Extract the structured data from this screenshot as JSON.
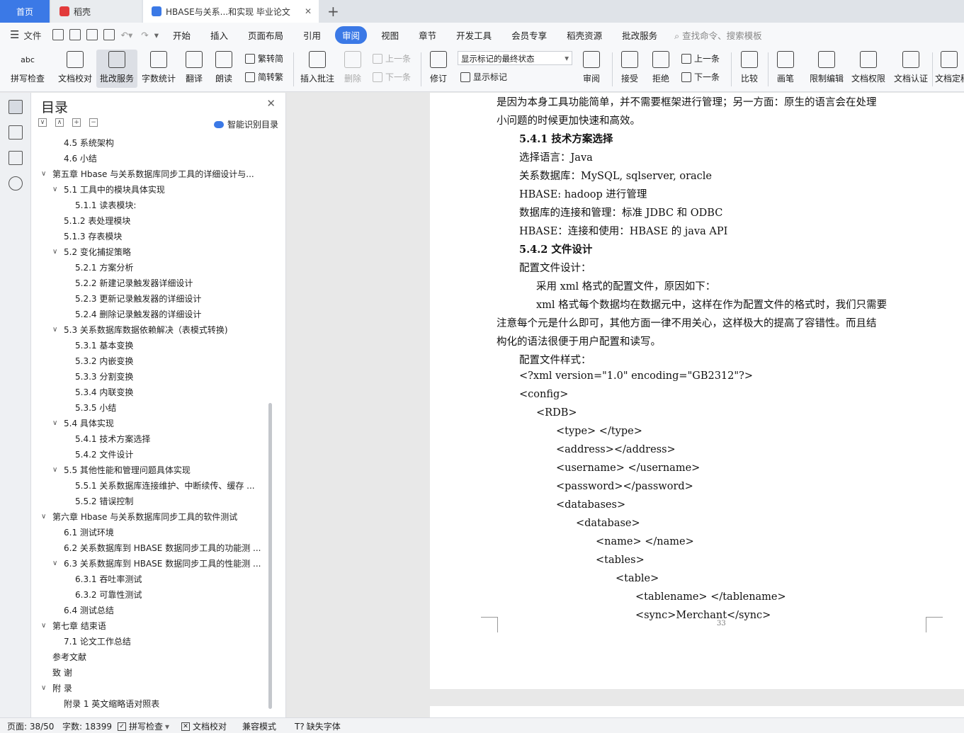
{
  "tabs": {
    "home": "首页",
    "daoke": "稻壳",
    "doc": "HBASE与关系...和实现 毕业论文",
    "close": "✕",
    "new": "+"
  },
  "menu": {
    "file": "文件",
    "items": [
      "开始",
      "插入",
      "页面布局",
      "引用",
      "审阅",
      "视图",
      "章节",
      "开发工具",
      "会员专享",
      "稻壳资源",
      "批改服务"
    ],
    "active": "审阅",
    "search": "查找命令、搜索模板"
  },
  "toolbar": {
    "spell": "拼写检查",
    "proof": "文档校对",
    "review_service": "批改服务",
    "wordcount": "字数统计",
    "translate": "翻译",
    "read": "朗读",
    "to_trad": "繁转简",
    "to_simp": "简转繁",
    "insert_comment": "插入批注",
    "delete": "删除",
    "prev_comment": "上一条",
    "next_comment": "下一条",
    "revise": "修订",
    "markup_state": "显示标记的最终状态",
    "show_markup": "显示标记",
    "review": "审阅",
    "accept": "接受",
    "reject": "拒绝",
    "prev_change": "上一条",
    "next_change": "下一条",
    "compare": "比较",
    "draw": "画笔",
    "restrict": "限制编辑",
    "permission": "文档权限",
    "certify": "文档认证",
    "finalize": "文档定稿"
  },
  "toc": {
    "title": "目录",
    "smart": "智能识别目录",
    "items": [
      {
        "text": "4.5  系统架构",
        "level": 2,
        "car": ""
      },
      {
        "text": "4.6  小结",
        "level": 2,
        "car": ""
      },
      {
        "text": "第五章   Hbase 与关系数据库同步工具的详细设计与...",
        "level": 1,
        "car": "∨"
      },
      {
        "text": "5.1   工具中的模块具体实现",
        "level": 2,
        "car": "∨"
      },
      {
        "text": "5.1.1   读表模块:",
        "level": 3,
        "car": ""
      },
      {
        "text": "5.1.2   表处理模块",
        "level": 2,
        "car": ""
      },
      {
        "text": "5.1.3   存表模块",
        "level": 2,
        "car": ""
      },
      {
        "text": "5.2   变化捕捉策略",
        "level": 2,
        "car": "∨"
      },
      {
        "text": "5.2.1   方案分析",
        "level": 3,
        "car": ""
      },
      {
        "text": "5.2.2   新建记录触发器详细设计",
        "level": 3,
        "car": ""
      },
      {
        "text": "5.2.3   更新记录触发器的详细设计",
        "level": 3,
        "car": ""
      },
      {
        "text": "5.2.4   删除记录触发器的详细设计",
        "level": 3,
        "car": ""
      },
      {
        "text": "5.3   关系数据库数据依赖解决（表模式转换)",
        "level": 2,
        "car": "∨"
      },
      {
        "text": "5.3.1   基本变换",
        "level": 3,
        "car": ""
      },
      {
        "text": "5.3.2   内嵌变换",
        "level": 3,
        "car": ""
      },
      {
        "text": "5.3.3   分割变换",
        "level": 3,
        "car": ""
      },
      {
        "text": "5.3.4   内联变换",
        "level": 3,
        "car": ""
      },
      {
        "text": "5.3.5   小结",
        "level": 3,
        "car": ""
      },
      {
        "text": "5.4   具体实现",
        "level": 2,
        "car": "∨"
      },
      {
        "text": "5.4.1   技术方案选择",
        "level": 3,
        "car": ""
      },
      {
        "text": "5.4.2   文件设计",
        "level": 3,
        "car": ""
      },
      {
        "text": "5.5  其他性能和管理问题具体实现",
        "level": 2,
        "car": "∨"
      },
      {
        "text": "5.5.1   关系数据库连接维护、中断续传、缓存 ...",
        "level": 3,
        "car": ""
      },
      {
        "text": "5.5.2   错误控制",
        "level": 3,
        "car": ""
      },
      {
        "text": "第六章   Hbase 与关系数据库同步工具的软件测试",
        "level": 1,
        "car": "∨"
      },
      {
        "text": "6.1   测试环境",
        "level": 2,
        "car": ""
      },
      {
        "text": "6.2   关系数据库到 HBASE 数据同步工具的功能测 ...",
        "level": 2,
        "car": ""
      },
      {
        "text": "6.3   关系数据库到 HBASE 数据同步工具的性能测 ...",
        "level": 2,
        "car": "∨"
      },
      {
        "text": "6.3.1   吞吐率测试",
        "level": 3,
        "car": ""
      },
      {
        "text": "6.3.2   可靠性测试",
        "level": 3,
        "car": ""
      },
      {
        "text": "6.4   测试总结",
        "level": 2,
        "car": ""
      },
      {
        "text": "第七章    结束语",
        "level": 1,
        "car": "∨"
      },
      {
        "text": "7.1   论文工作总结",
        "level": 2,
        "car": ""
      },
      {
        "text": "参考文献",
        "level": 1,
        "car": ""
      },
      {
        "text": "致      谢",
        "level": 1,
        "car": ""
      },
      {
        "text": "附      录",
        "level": 1,
        "car": "∨"
      },
      {
        "text": "附录 1    英文缩略语对照表",
        "level": 2,
        "car": ""
      }
    ]
  },
  "document": {
    "lines": [
      {
        "text": "是因为本身工具功能简单，并不需要框架进行管理；另一方面：原生的语言会在处理",
        "indent": 0,
        "h": false
      },
      {
        "text": "小问题的时候更加快速和高效。",
        "indent": 0,
        "h": false
      },
      {
        "text": "5.4.1    技术方案选择",
        "indent": 1,
        "h": true
      },
      {
        "text": "选择语言：Java",
        "indent": 1,
        "h": false
      },
      {
        "text": "关系数据库：MySQL, sqlserver, oracle",
        "indent": 1,
        "h": false
      },
      {
        "text": "HBASE: hadoop 进行管理",
        "indent": 1,
        "h": false
      },
      {
        "text": "数据库的连接和管理：标准 JDBC 和 ODBC",
        "indent": 1,
        "h": false
      },
      {
        "text": "HBASE：连接和使用：HBASE 的 java API",
        "indent": 1,
        "h": false
      },
      {
        "text": "5.4.2    文件设计",
        "indent": 1,
        "h": true
      },
      {
        "text": "配置文件设计：",
        "indent": 1,
        "h": false
      },
      {
        "text": "采用 xml 格式的配置文件，原因如下：",
        "indent": 2,
        "h": false
      },
      {
        "text": "xml 格式每个数据均在数据元中，这样在作为配置文件的格式时，我们只需要",
        "indent": 2,
        "h": false
      },
      {
        "text": "注意每个元是什么即可，其他方面一律不用关心，这样极大的提高了容错性。而且结",
        "indent": 0,
        "h": false
      },
      {
        "text": "构化的语法很便于用户配置和读写。",
        "indent": 0,
        "h": false
      },
      {
        "text": "配置文件样式：",
        "indent": 1,
        "h": false
      },
      {
        "text": "<?xml version=\"1.0\" encoding=\"GB2312\"?>",
        "indent": 1,
        "h": false
      },
      {
        "text": "<config>",
        "indent": 1,
        "h": false
      },
      {
        "text": "<RDB>",
        "indent": 2,
        "h": false
      },
      {
        "text": "<type> </type>",
        "indent": 3,
        "h": false
      },
      {
        "text": "<address></address>",
        "indent": 3,
        "h": false
      },
      {
        "text": "<username> </username>",
        "indent": 3,
        "h": false
      },
      {
        "text": "<password></password>",
        "indent": 3,
        "h": false
      },
      {
        "text": "<databases>",
        "indent": 3,
        "h": false
      },
      {
        "text": "<database>",
        "indent": 4,
        "h": false
      },
      {
        "text": "<name> </name>",
        "indent": 5,
        "h": false
      },
      {
        "text": "<tables>",
        "indent": 5,
        "h": false
      },
      {
        "text": "<table>",
        "indent": 6,
        "h": false
      },
      {
        "text": "<tablename> </tablename>",
        "indent": 7,
        "h": false
      },
      {
        "text": "<sync>Merchant</sync>",
        "indent": 7,
        "h": false
      }
    ],
    "page_number": "33"
  },
  "status": {
    "page": "页面: 38/50",
    "words": "字数: 18399",
    "spell": "拼写检查",
    "proof": "文档校对",
    "compat": "兼容模式",
    "missing_font": "缺失字体"
  },
  "colors": {
    "accent": "#3b79e6"
  }
}
